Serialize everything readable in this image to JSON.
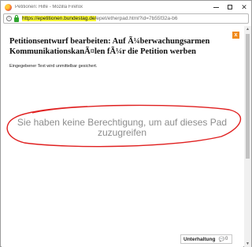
{
  "window": {
    "title": "Petitionen: Hilfe - Mozilla Firefox",
    "minimize": "",
    "maximize": "",
    "close": "✕"
  },
  "urlbar": {
    "info": "i",
    "url_scheme_domain": "https://epetitionen.bundestag.de/",
    "url_path": "epet/etherpad.html?id=7b55f32a-b6"
  },
  "page": {
    "close": "x",
    "heading": "Petitionsentwurf bearbeiten: Auf Ã¼berwachungsarmen KommunikationskanÃ¤len fÃ¼r die Petition werben",
    "note": "Eingegebener Text wird unmittelbar gesichert.",
    "message": "Sie haben keine Berechtigung, um auf dieses Pad zuzugreifen",
    "chat_label": "Unterhaltung",
    "chat_icon": "💬",
    "chat_count": "0"
  },
  "colors": {
    "highlight": "#f5f536",
    "annotation_red": "#e02020",
    "close_orange": "#f08a1c"
  }
}
